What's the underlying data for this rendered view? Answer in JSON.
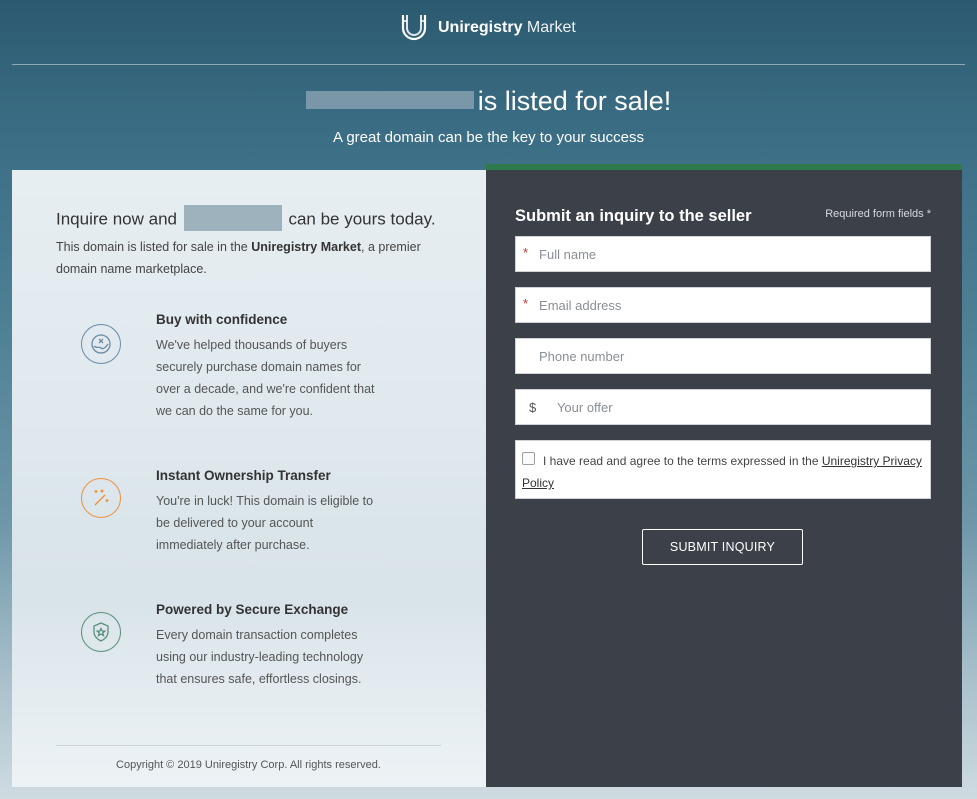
{
  "brand": {
    "name_bold": "Uniregistry",
    "name_light": "Market"
  },
  "hero": {
    "title": "is listed for sale!",
    "subtitle": "A great domain can be the key to your success"
  },
  "left": {
    "title_before": "Inquire now and",
    "title_after": "can be yours today.",
    "desc_before": "This domain is listed for sale in the ",
    "desc_bold": "Uniregistry Market",
    "desc_after": ", a premier domain name marketplace.",
    "features": [
      {
        "title": "Buy with confidence",
        "body": "We've helped thousands of buyers securely purchase domain names for over a decade, and we're confident that we can do the same for you.",
        "icon": "handshake-icon"
      },
      {
        "title": "Instant Ownership Transfer",
        "body": "You're in luck! This domain is eligible to be delivered to your account immediately after purchase.",
        "icon": "magic-wand-icon"
      },
      {
        "title": "Powered by Secure Exchange",
        "body": "Every domain transaction completes using our industry-leading technology that ensures safe, effortless closings.",
        "icon": "shield-star-icon"
      }
    ],
    "copyright": "Copyright © 2019 Uniregistry Corp. All rights reserved."
  },
  "form": {
    "title": "Submit an inquiry to the seller",
    "required_note": "Required form fields *",
    "required_marker": "*",
    "fullname_placeholder": "Full name",
    "email_placeholder": "Email address",
    "phone_placeholder": "Phone number",
    "currency_symbol": "$",
    "offer_placeholder": "Your offer",
    "terms_text": "I have read and agree to the terms expressed in the ",
    "terms_link": "Uniregistry Privacy Policy",
    "submit_label": "SUBMIT INQUIRY"
  },
  "colors": {
    "accent_green": "#2f7a4c",
    "form_bg": "#3c4049",
    "required_red": "#c0392b"
  }
}
